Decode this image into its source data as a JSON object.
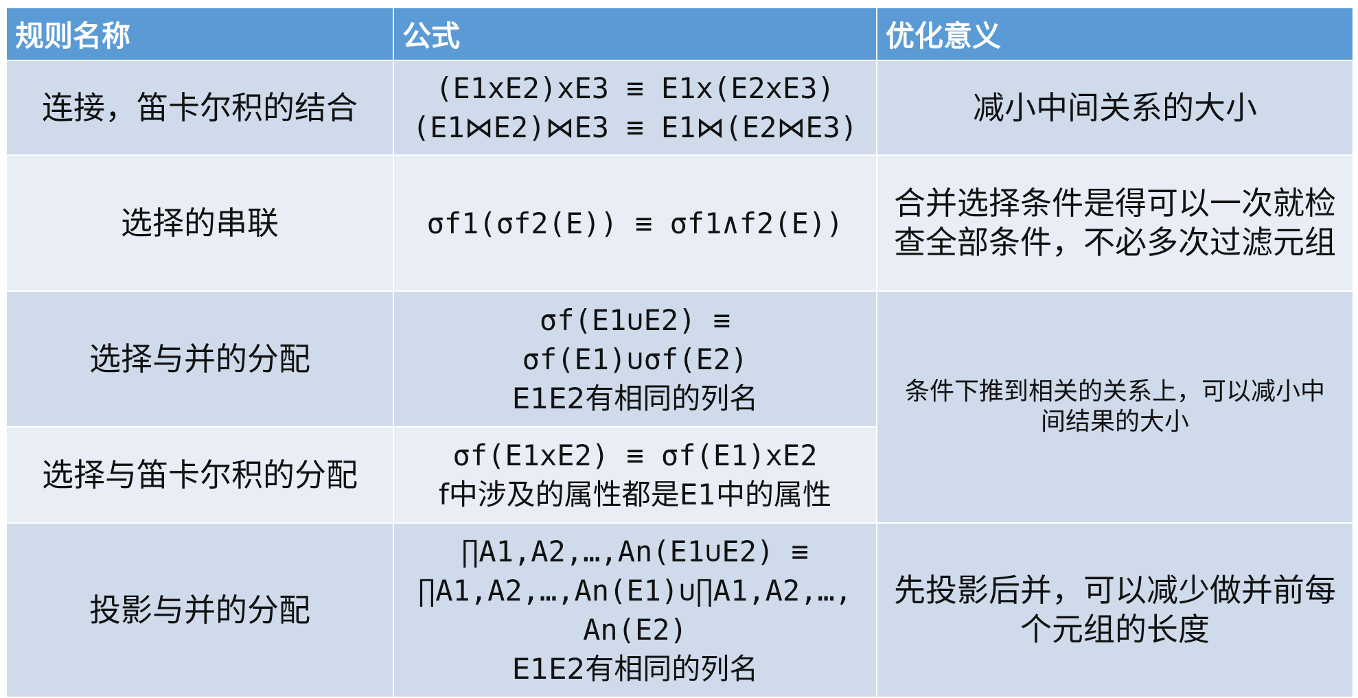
{
  "headers": [
    "规则名称",
    "公式",
    "优化意义"
  ],
  "rows": [
    {
      "name": "连接，笛卡尔积的结合",
      "formula": [
        "(E1xE2)xE3 ≡ E1x(E2xE3)",
        "(E1⋈E2)⋈E3 ≡ E1⋈(E2⋈E3)"
      ],
      "optimization": "减小中间关系的大小"
    },
    {
      "name": "选择的串联",
      "formula": [
        "σf1(σf2(E)) ≡ σf1∧f2(E))"
      ],
      "optimization": "合并选择条件是得可以一次就检查全部条件，不必多次过滤元组"
    },
    {
      "name": "选择与并的分配",
      "formula": [
        "σf(E1∪E2) ≡",
        "σf(E1)∪σf(E2)",
        "E1E2有相同的列名"
      ]
    },
    {
      "name": "选择与笛卡尔积的分配",
      "formula": [
        "σf(E1xE2) ≡ σf(E1)xE2",
        "f中涉及的属性都是E1中的属性"
      ]
    },
    {
      "name": "投影与并的分配",
      "formula": [
        "∏A1,A2,…,An(E1∪E2) ≡",
        "∏A1,A2,…,An(E1)∪∏A1,A2,…,",
        "An(E2)",
        "E1E2有相同的列名"
      ],
      "optimization": "先投影后并，可以减少做并前每个元组的长度"
    }
  ],
  "merged_optimization": "条件下推到相关的关系上，可以减小中间结果的大小"
}
